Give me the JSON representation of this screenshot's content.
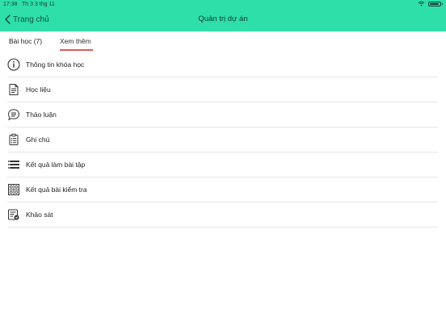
{
  "status_bar": {
    "time": "17:38",
    "date": "Th 3 3 thg 11"
  },
  "nav": {
    "back_label": "Trang chủ",
    "title": "Quản trị dự án"
  },
  "tabs": [
    {
      "label": "Bài học (7)",
      "active": false
    },
    {
      "label": "Xem thêm",
      "active": true
    }
  ],
  "menu": [
    {
      "label": "Thông tin khóa học",
      "icon": "info-icon"
    },
    {
      "label": "Học liệu",
      "icon": "document-icon"
    },
    {
      "label": "Thảo luận",
      "icon": "chat-icon"
    },
    {
      "label": "Ghi chú",
      "icon": "clipboard-icon"
    },
    {
      "label": "Kết quả làm bài tập",
      "icon": "list-bars-icon"
    },
    {
      "label": "Kết quả bài kiểm tra",
      "icon": "abc-test-icon"
    },
    {
      "label": "Khảo sát",
      "icon": "survey-icon"
    }
  ],
  "colors": {
    "header_bg": "#2ee0a8",
    "tab_underline": "#e05a5f"
  }
}
